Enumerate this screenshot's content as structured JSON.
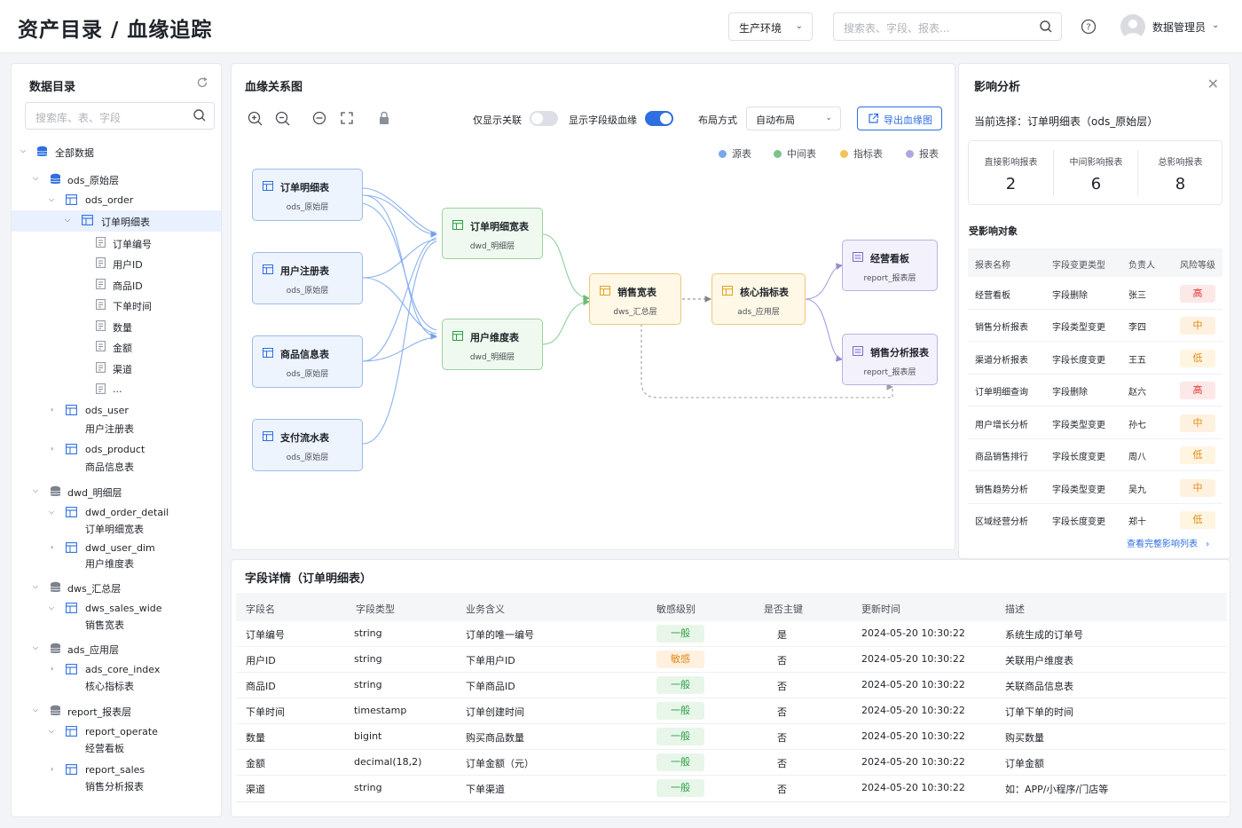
{
  "header": {
    "title": "资产目录 / 血缘追踪",
    "env": "生产环境",
    "search_placeholder": "搜索表、字段、报表...",
    "user": "数据管理员"
  },
  "catalog": {
    "title": "数据目录",
    "search_placeholder": "搜索库、表、字段",
    "root": "全部数据",
    "ods": "ods_原始层",
    "ods_order": "ods_order",
    "order_detail": "订单明细表",
    "fields": [
      "订单编号",
      "用户ID",
      "商品ID",
      "下单时间",
      "数量",
      "金额",
      "渠道",
      "..."
    ],
    "ods_user": "ods_user",
    "ods_user_desc": "用户注册表",
    "ods_product": "ods_product",
    "ods_product_desc": "商品信息表",
    "dwd": "dwd_明细层",
    "dwd_order_detail": "dwd_order_detail",
    "dwd_order_detail_desc": "订单明细宽表",
    "dwd_user_dim": "dwd_user_dim",
    "dwd_user_dim_desc": "用户维度表",
    "dws": "dws_汇总层",
    "dws_sales_wide": "dws_sales_wide",
    "dws_sales_wide_desc": "销售宽表",
    "ads": "ads_应用层",
    "ads_core_index": "ads_core_index",
    "ads_core_index_desc": "核心指标表",
    "report": "report_报表层",
    "report_operate": "report_operate",
    "report_operate_desc": "经营看板",
    "report_sales": "report_sales",
    "report_sales_desc": "销售分析报表"
  },
  "graph": {
    "title": "血缘关系图",
    "only_related": "仅显示关联",
    "show_field": "显示字段级血缘",
    "layout_label": "布局方式",
    "layout_value": "自动布局",
    "export": "导出血缘图",
    "legend": [
      "源表",
      "中间表",
      "指标表",
      "报表"
    ],
    "nodes": {
      "n1": {
        "name": "订单明细表",
        "layer": "ods_原始层"
      },
      "n2": {
        "name": "用户注册表",
        "layer": "ods_原始层"
      },
      "n3": {
        "name": "商品信息表",
        "layer": "ods_原始层"
      },
      "n4": {
        "name": "支付流水表",
        "layer": "ods_原始层"
      },
      "n5": {
        "name": "订单明细宽表",
        "layer": "dwd_明细层"
      },
      "n6": {
        "name": "用户维度表",
        "layer": "dwd_明细层"
      },
      "n7": {
        "name": "销售宽表",
        "layer": "dws_汇总层"
      },
      "n8": {
        "name": "核心指标表",
        "layer": "ads_应用层"
      },
      "n9": {
        "name": "经营看板",
        "layer": "report_报表层"
      },
      "n10": {
        "name": "销售分析报表",
        "layer": "report_报表层"
      }
    }
  },
  "colors": {
    "source": "#7aa7ec",
    "middle": "#7cc38a",
    "index": "#f0c45c",
    "report": "#b3a6e0",
    "accent": "#2e6fe0"
  },
  "impact": {
    "title": "影响分析",
    "current": "当前选择：订单明细表（ods_原始层）",
    "stats": [
      {
        "label": "直接影响报表",
        "value": "2"
      },
      {
        "label": "中间影响报表",
        "value": "6"
      },
      {
        "label": "总影响报表",
        "value": "8"
      }
    ],
    "affected_title": "受影响对象",
    "columns": [
      "报表名称",
      "字段变更类型",
      "负责人",
      "风险等级"
    ],
    "rows": [
      [
        "经营看板",
        "字段删除",
        "张三",
        "高"
      ],
      [
        "销售分析报表",
        "字段类型变更",
        "李四",
        "中"
      ],
      [
        "渠道分析报表",
        "字段长度变更",
        "王五",
        "低"
      ],
      [
        "订单明细查询",
        "字段删除",
        "赵六",
        "高"
      ],
      [
        "用户增长分析",
        "字段类型变更",
        "孙七",
        "中"
      ],
      [
        "商品销售排行",
        "字段长度变更",
        "周八",
        "低"
      ],
      [
        "销售趋势分析",
        "字段类型变更",
        "吴九",
        "中"
      ],
      [
        "区域经营分析",
        "字段长度变更",
        "郑十",
        "低"
      ]
    ],
    "view_all": "查看完整影响列表"
  },
  "fields": {
    "title": "字段详情（订单明细表）",
    "columns": [
      "字段名",
      "字段类型",
      "业务含义",
      "敏感级别",
      "是否主键",
      "更新时间",
      "描述"
    ],
    "rows": [
      [
        "订单编号",
        "string",
        "订单的唯一编号",
        "一般",
        "是",
        "2024-05-20 10:30:22",
        "系统生成的订单号"
      ],
      [
        "用户ID",
        "string",
        "下单用户ID",
        "敏感",
        "否",
        "2024-05-20 10:30:22",
        "关联用户维度表"
      ],
      [
        "商品ID",
        "string",
        "下单商品ID",
        "一般",
        "否",
        "2024-05-20 10:30:22",
        "关联商品信息表"
      ],
      [
        "下单时间",
        "timestamp",
        "订单创建时间",
        "一般",
        "否",
        "2024-05-20 10:30:22",
        "订单下单的时间"
      ],
      [
        "数量",
        "bigint",
        "购买商品数量",
        "一般",
        "否",
        "2024-05-20 10:30:22",
        "购买数量"
      ],
      [
        "金额",
        "decimal(18,2)",
        "订单金额（元）",
        "一般",
        "否",
        "2024-05-20 10:30:22",
        "订单金额"
      ],
      [
        "渠道",
        "string",
        "下单渠道",
        "一般",
        "否",
        "2024-05-20 10:30:22",
        "如：APP/小程序/门店等"
      ]
    ]
  }
}
